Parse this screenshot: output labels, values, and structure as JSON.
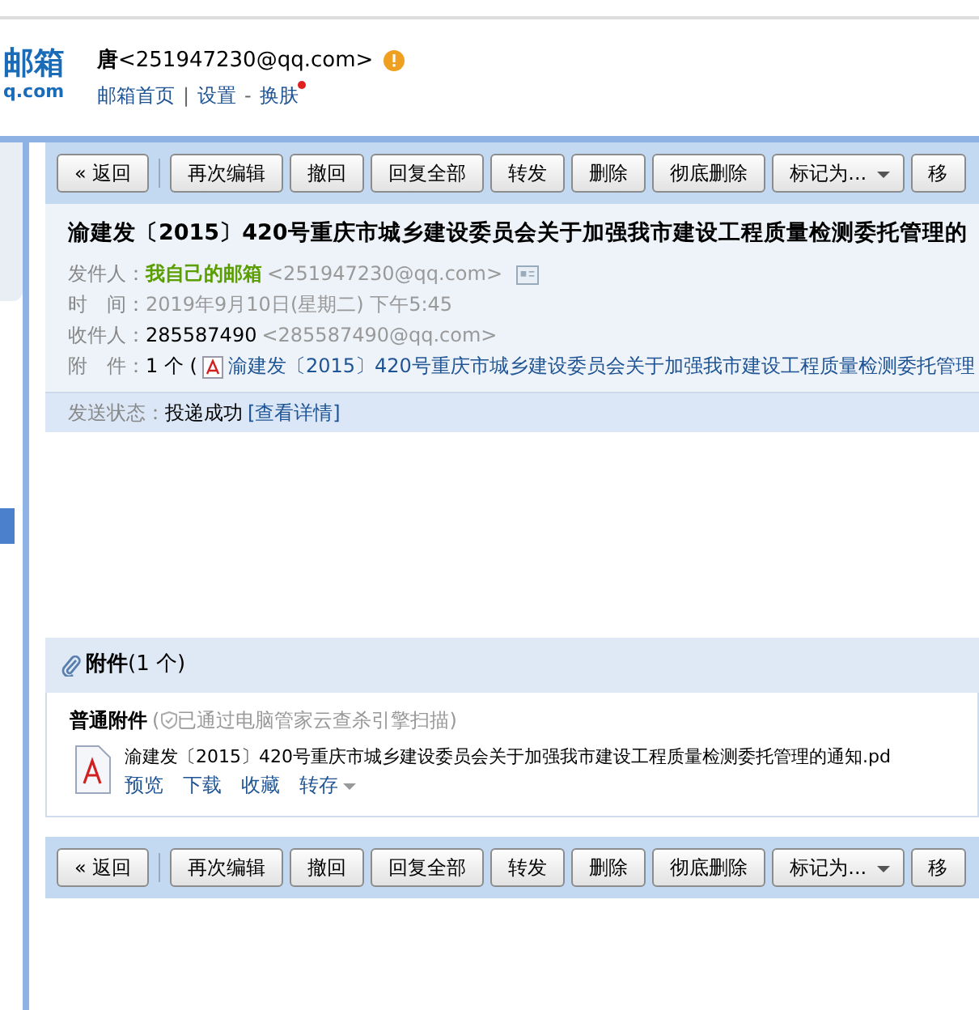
{
  "logo": {
    "name": "邮箱",
    "domain": "q.com"
  },
  "account": {
    "user": "**唐**<251947230@qq.com>",
    "links": [
      {
        "label": "邮箱首页",
        "new": false
      },
      {
        "label": "设置",
        "separator": "|",
        "new": false
      },
      {
        "label": "换肤",
        "separator": "-",
        "new": true
      }
    ]
  },
  "toolbar_top": [
    {
      "label": "« 返回",
      "kind": "back"
    },
    {
      "label": "再次编辑",
      "kind": "button"
    },
    {
      "label": "撤回",
      "kind": "button"
    },
    {
      "label": "回复全部",
      "kind": "button"
    },
    {
      "label": "转发",
      "kind": "button"
    },
    {
      "label": "删除",
      "kind": "button"
    },
    {
      "label": "彻底删除",
      "kind": "button"
    },
    {
      "label": "标记为...",
      "kind": "dropdown"
    },
    {
      "label": "移",
      "kind": "button"
    }
  ],
  "mail": {
    "subject": "渝建发〔2015〕420号重庆市城乡建设委员会关于加强我市建设工程质量检测委托管理的",
    "from_label": "发件人：",
    "from_name": "我自己的邮箱",
    "from_address": "<251947230@qq.com>",
    "time_label": "时　间：",
    "time": "2019年9月10日(星期二) 下午5:45",
    "to_label": "收件人：",
    "to_name": "285587490",
    "to_address": "<285587490@qq.com>",
    "attach_label": "附　件：",
    "attach_count": "1 个 (",
    "attach_link": "渝建发〔2015〕420号重庆市城乡建设委员会关于加强我市建设工程质量检测委托管理",
    "status_label": "发送状态：",
    "status": "投递成功",
    "status_link": "[查看详情]"
  },
  "attachments": {
    "title": "附件",
    "count": "(1 个)",
    "section": "普通附件",
    "scan_prefix": "(",
    "scan_note": "已通过电脑管家云查杀引擎扫描)",
    "files": [
      {
        "name": "渝建发〔2015〕420号重庆市城乡建设委员会关于加强我市建设工程质量检测委托管理的通知.pd",
        "actions": [
          {
            "label": "预览",
            "kind": "link"
          },
          {
            "label": "下载",
            "kind": "link"
          },
          {
            "label": "收藏",
            "kind": "link"
          },
          {
            "label": "转存",
            "kind": "dropdown"
          }
        ]
      }
    ]
  },
  "toolbar_bottom": [
    {
      "label": "« 返回",
      "kind": "back"
    },
    {
      "label": "再次编辑",
      "kind": "button"
    },
    {
      "label": "撤回",
      "kind": "button"
    },
    {
      "label": "回复全部",
      "kind": "button"
    },
    {
      "label": "转发",
      "kind": "button"
    },
    {
      "label": "删除",
      "kind": "button"
    },
    {
      "label": "彻底删除",
      "kind": "button"
    },
    {
      "label": "标记为...",
      "kind": "dropdown"
    },
    {
      "label": "移",
      "kind": "button"
    }
  ]
}
